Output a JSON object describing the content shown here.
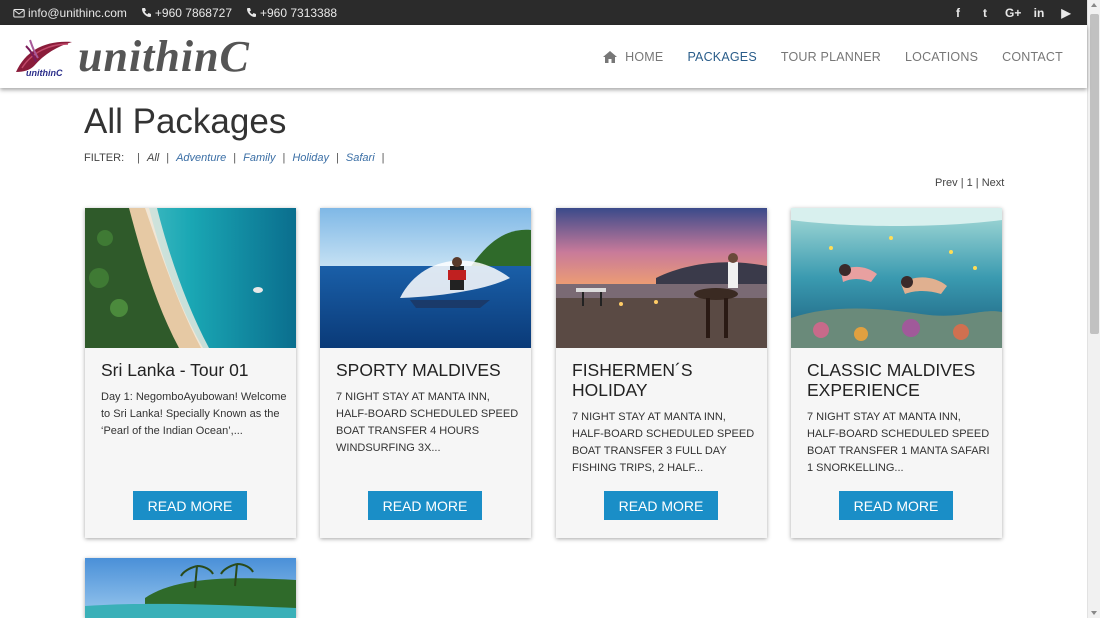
{
  "topbar": {
    "email": "info@unithinc.com",
    "phone1": "+960 7868727",
    "phone2": "+960 7313388",
    "social": [
      {
        "icon": "facebook-icon",
        "glyph": "f"
      },
      {
        "icon": "twitter-icon",
        "glyph": "t"
      },
      {
        "icon": "google-plus-icon",
        "glyph": "G+"
      },
      {
        "icon": "linkedin-icon",
        "glyph": "in"
      },
      {
        "icon": "youtube-icon",
        "glyph": "▶"
      }
    ]
  },
  "header": {
    "logo_small": "unithinC",
    "logo_word": "unithinC",
    "nav": [
      {
        "label": "HOME",
        "icon": "home-icon",
        "active": false
      },
      {
        "label": "PACKAGES",
        "active": true
      },
      {
        "label": "TOUR PLANNER",
        "active": false
      },
      {
        "label": "LOCATIONS",
        "active": false
      },
      {
        "label": "CONTACT",
        "active": false
      }
    ]
  },
  "main": {
    "title": "All Packages",
    "filter": {
      "label": "FILTER:",
      "items": [
        "All",
        "Adventure",
        "Family",
        "Holiday",
        "Safari"
      ]
    },
    "pager": {
      "prev": "Prev",
      "page": "1",
      "next": "Next"
    },
    "cards": [
      {
        "title": "Sri Lanka - Tour 01",
        "desc": "Day 1: NegomboAyubowan! Welcome to Sri Lanka! Specially Known as the ‘Pearl of the Indian Ocean’,...",
        "button": "READ MORE",
        "image": "beach-aerial"
      },
      {
        "title": "SPORTY MALDIVES",
        "desc": "7 NIGHT STAY AT MANTA INN, HALF-BOARD SCHEDULED SPEED BOAT TRANSFER 4 HOURS WINDSURFING 3X...",
        "button": "READ MORE",
        "image": "jet-ski"
      },
      {
        "title": "FISHERMEN´S HOLIDAY",
        "desc": "7 NIGHT STAY AT MANTA INN, HALF-BOARD SCHEDULED SPEED BOAT TRANSFER 3 FULL DAY FISHING TRIPS, 2 HALF...",
        "button": "READ MORE",
        "image": "beach-dinner"
      },
      {
        "title": "CLASSIC MALDIVES EXPERIENCE",
        "desc": "7 NIGHT STAY AT MANTA INN, HALF-BOARD SCHEDULED SPEED BOAT TRANSFER 1 MANTA SAFARI 1 SNORKELLING...",
        "button": "READ MORE",
        "image": "snorkelling"
      }
    ]
  },
  "colors": {
    "topbar_bg": "#2b2b2b",
    "accent": "#1a8ec7",
    "nav_active": "#2a5d8a",
    "link": "#3a6ea5"
  }
}
